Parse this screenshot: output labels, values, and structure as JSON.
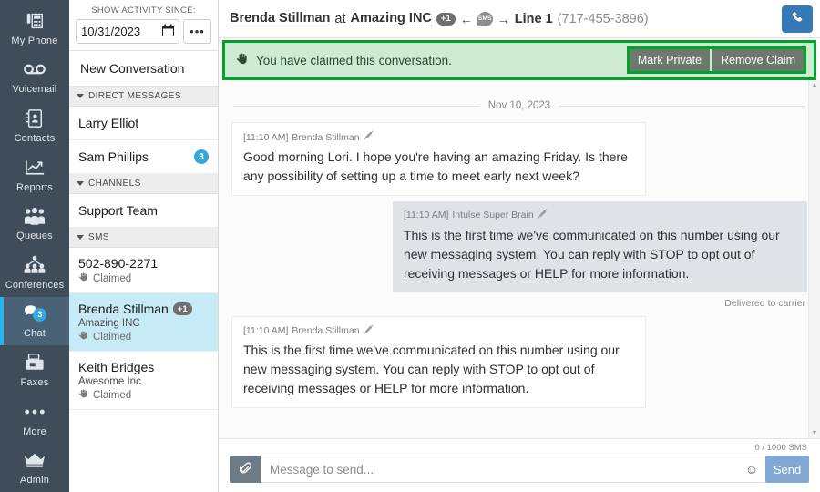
{
  "rail": {
    "items": [
      {
        "label": "My Phone",
        "icon": "desk-phone-icon",
        "badge": null,
        "active": false
      },
      {
        "label": "Voicemail",
        "icon": "voicemail-icon",
        "badge": null,
        "active": false
      },
      {
        "label": "Contacts",
        "icon": "contacts-book-icon",
        "badge": null,
        "active": false
      },
      {
        "label": "Reports",
        "icon": "chart-line-icon",
        "badge": null,
        "active": false
      },
      {
        "label": "Queues",
        "icon": "people-queue-icon",
        "badge": null,
        "active": false
      },
      {
        "label": "Conferences",
        "icon": "conference-icon",
        "badge": null,
        "active": false
      },
      {
        "label": "Chat",
        "icon": "chat-bubbles-icon",
        "badge": "3",
        "active": true
      },
      {
        "label": "Faxes",
        "icon": "fax-icon",
        "badge": null,
        "active": false
      },
      {
        "label": "More",
        "icon": "ellipsis-icon",
        "badge": null,
        "active": false
      },
      {
        "label": "Admin",
        "icon": "crown-icon",
        "badge": null,
        "active": false
      }
    ]
  },
  "list": {
    "since_label": "SHOW ACTIVITY SINCE:",
    "since_value": "10/31/2023",
    "calendar_icon": "calendar-icon",
    "more_button": "•••",
    "new_conversation": "New Conversation",
    "groups": [
      {
        "name": "DIRECT MESSAGES",
        "items": [
          {
            "name": "Larry Elliot",
            "org": null,
            "claim": null,
            "badge": null,
            "selected": false
          },
          {
            "name": "Sam Phillips",
            "org": null,
            "claim": null,
            "badge": "3",
            "selected": false
          }
        ]
      },
      {
        "name": "CHANNELS",
        "items": [
          {
            "name": "Support Team",
            "org": null,
            "claim": null,
            "badge": null,
            "selected": false
          }
        ]
      },
      {
        "name": "SMS",
        "items": [
          {
            "name": "502-890-2271",
            "org": null,
            "claim": "Claimed",
            "badge": null,
            "selected": false
          },
          {
            "name": "Brenda Stillman",
            "org": "Amazing INC",
            "claim": "Claimed",
            "badge": "+1",
            "selected": true
          },
          {
            "name": "Keith Bridges",
            "org": "Awesome Inc",
            "claim": "Claimed",
            "badge": null,
            "selected": false
          }
        ]
      }
    ]
  },
  "header": {
    "person": "Brenda Stillman",
    "at": "at",
    "org": "Amazing INC",
    "org_badge": "+1",
    "arrow_left": "←",
    "channel_icon_label": "SMS",
    "arrow_right": "→",
    "line": "Line 1",
    "number": "(717-455-3896)",
    "call_icon": "phone-handset-icon"
  },
  "banner": {
    "claim_icon": "claim-hand-icon",
    "text": "You have claimed this conversation.",
    "mark_private": "Mark Private",
    "remove_claim": "Remove Claim"
  },
  "conversation": {
    "date_divider": "Nov 10, 2023",
    "messages": [
      {
        "time": "[11:10 AM]",
        "author": "Brenda Stillman",
        "no_edit_icon": "no-pencil-icon",
        "body": "Good morning Lori. I hope you're having an amazing Friday. Is there any possibility of setting up a time to meet early next week?",
        "side": "left",
        "style": "white",
        "status": null
      },
      {
        "time": "[11:10 AM]",
        "author": "Intulse Super Brain",
        "no_edit_icon": "no-pencil-icon",
        "body": "This is the first time we've communicated on this number using our new messaging system. You can reply with STOP to opt out of receiving messages or HELP for more information.",
        "side": "right",
        "style": "gray",
        "status": "Delivered to carrier"
      },
      {
        "time": "[11:10 AM]",
        "author": "Brenda Stillman",
        "no_edit_icon": "no-pencil-icon",
        "body": "This is the first time we've communicated on this number using our new messaging system. You can reply with STOP to opt out of receiving messages or HELP for more information.",
        "side": "left",
        "style": "white",
        "status": null
      }
    ]
  },
  "composer": {
    "counter": "0 / 1000 SMS",
    "attach_icon": "paperclip-icon",
    "placeholder": "Message to send...",
    "value": "",
    "emoji_icon": "smiley-icon",
    "send_label": "Send"
  },
  "colors": {
    "rail_bg": "#3f4c59",
    "rail_active": "#4a6276",
    "accent_cyan": "#2fa8dd",
    "selected_row": "#c7eaf7",
    "banner_bg": "#ccebd2",
    "highlight_green": "#00a32a",
    "call_blue": "#3779b5",
    "send_blue": "#80a8d2"
  }
}
